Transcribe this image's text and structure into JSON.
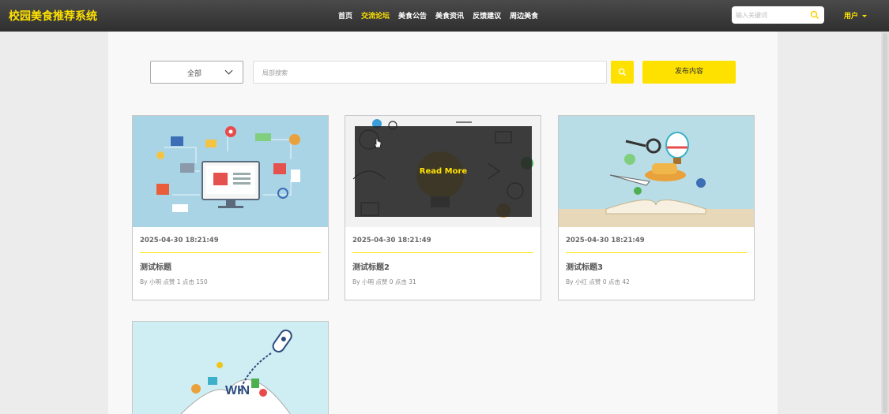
{
  "header": {
    "brand": "校园美食推荐系统",
    "nav": [
      "首页",
      "交流论坛",
      "美食公告",
      "美食资讯",
      "反馈建议",
      "周边美食"
    ],
    "active_nav": "交流论坛",
    "search_placeholder": "输入关键词",
    "user_label": "用户"
  },
  "toolbar": {
    "filter_value": "全部",
    "search_placeholder": "局部搜索",
    "publish_label": "发布内容"
  },
  "colors": {
    "accent": "#ffe100",
    "topbar": "#3a3a3a"
  },
  "posts": [
    {
      "date": "2025-04-30 18:21:49",
      "title": "测试标题",
      "meta": "By 小明  点赞 1  点击 150",
      "image": "online-shopping-illustration"
    },
    {
      "date": "2025-04-30 18:21:49",
      "title": "测试标题2",
      "meta": "By 小明  点赞 0  点击 31",
      "image": "learn-lightbulb-illustration",
      "overlay": "Read More"
    },
    {
      "date": "2025-04-30 18:21:49",
      "title": "测试标题3",
      "meta": "By 小红  点赞 0  点击 42",
      "image": "open-book-travel-illustration"
    },
    {
      "image": "rocket-win-book-illustration"
    }
  ]
}
